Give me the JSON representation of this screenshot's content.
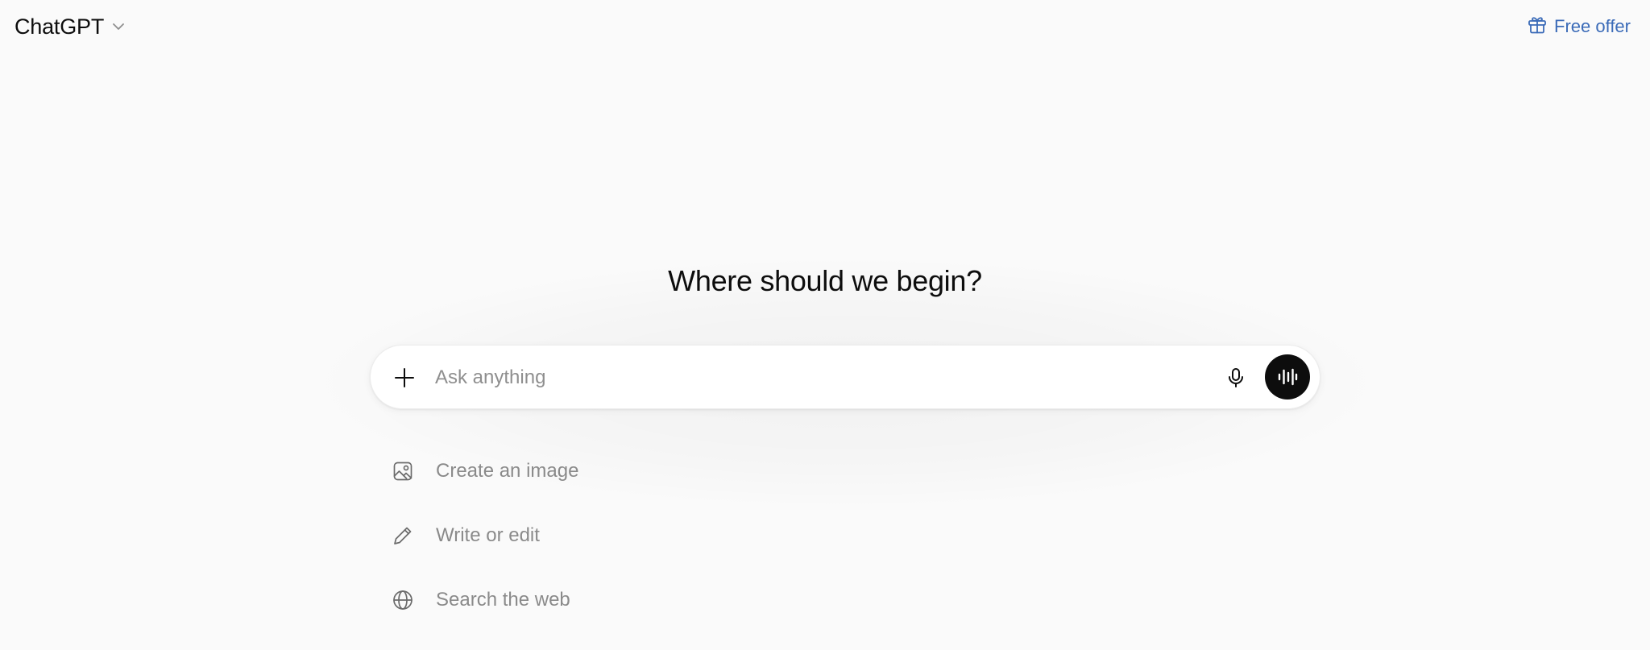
{
  "header": {
    "model_name": "ChatGPT",
    "free_offer_label": "Free offer",
    "accent_color": "#3b6bb8"
  },
  "main": {
    "headline": "Where should we begin?",
    "composer": {
      "placeholder": "Ask anything",
      "value": ""
    },
    "suggestions": [
      {
        "label": "Create an image",
        "icon": "image-icon"
      },
      {
        "label": "Write or edit",
        "icon": "pencil-icon"
      },
      {
        "label": "Search the web",
        "icon": "globe-icon"
      }
    ]
  }
}
